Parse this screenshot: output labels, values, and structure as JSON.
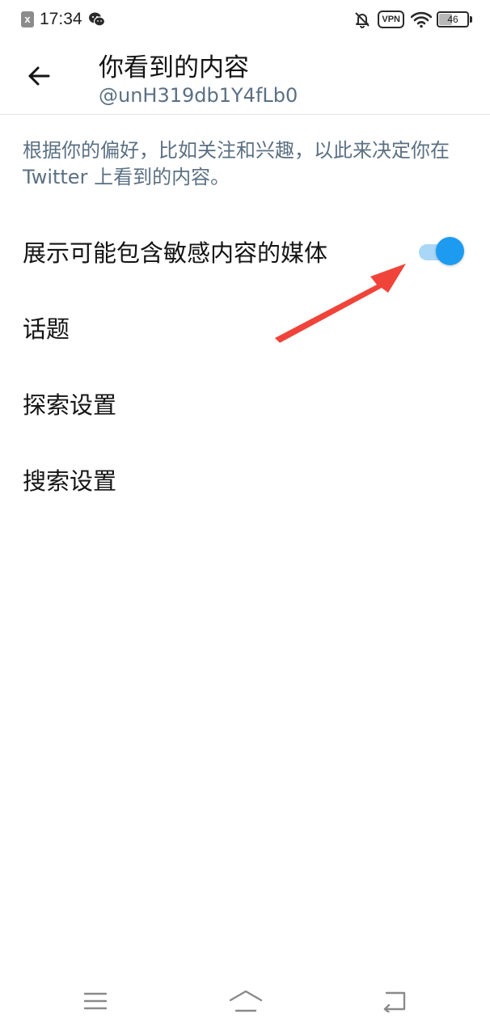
{
  "status_bar": {
    "time": "17:34",
    "vpn_label": "VPN",
    "battery_level": "46",
    "battery_fraction": 0.46,
    "notification_icon_glyph": "x",
    "icons": [
      "notification-x-icon",
      "wechat-icon",
      "bell-off-icon",
      "vpn-icon",
      "wifi-icon",
      "battery-icon"
    ]
  },
  "header": {
    "title": "你看到的内容",
    "subtitle": "@unH319db1Y4fLb0",
    "back_icon": "arrow-left-icon"
  },
  "main": {
    "description": "根据你的偏好，比如关注和兴趣，以此来决定你在 Twitter 上看到的内容。",
    "settings": [
      {
        "label": "展示可能包含敏感内容的媒体",
        "toggle_on": true
      },
      {
        "label": "话题"
      },
      {
        "label": "探索设置"
      },
      {
        "label": "搜索设置"
      }
    ]
  },
  "annotation": {
    "icon": "red-arrow-icon",
    "color": "#f0443a"
  },
  "nav_bar": {
    "icons": [
      "menu-icon",
      "home-icon",
      "back-icon"
    ]
  },
  "colors": {
    "accent": "#1d9bf0",
    "accent_track": "#a9d7f8",
    "secondary_text": "#5b7083",
    "divider": "#e3e6e8"
  }
}
